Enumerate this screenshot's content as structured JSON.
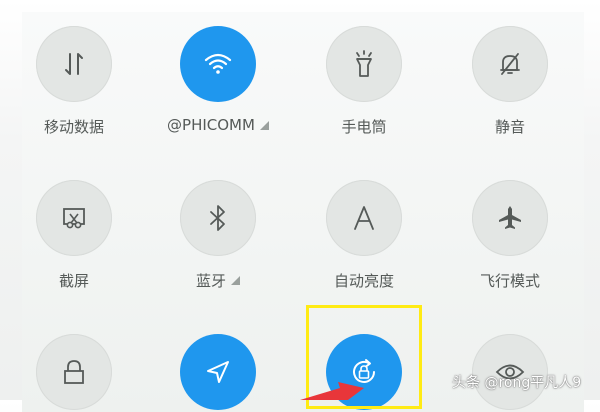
{
  "quick_settings": {
    "tiles": [
      {
        "label": "移动数据",
        "icon": "mobile-data-icon",
        "active": false
      },
      {
        "label": "@PHICOMM",
        "icon": "wifi-icon",
        "active": true,
        "has_submenu": true
      },
      {
        "label": "手电筒",
        "icon": "flashlight-icon",
        "active": false
      },
      {
        "label": "静音",
        "icon": "mute-bell-icon",
        "active": false
      },
      {
        "label": "截屏",
        "icon": "screenshot-icon",
        "active": false
      },
      {
        "label": "蓝牙",
        "icon": "bluetooth-icon",
        "active": false,
        "has_submenu": true
      },
      {
        "label": "自动亮度",
        "icon": "auto-brightness-icon",
        "active": false
      },
      {
        "label": "飞行模式",
        "icon": "airplane-icon",
        "active": false
      },
      {
        "label": "",
        "icon": "lock-icon",
        "active": false
      },
      {
        "label": "",
        "icon": "location-icon",
        "active": true
      },
      {
        "label": "",
        "icon": "rotation-lock-icon",
        "active": true
      },
      {
        "label": "",
        "icon": "eye-comfort-icon",
        "active": false
      }
    ]
  },
  "watermark": "头条 @rong平凡人9",
  "colors": {
    "active": "#1f97ee",
    "inactive": "#e3e6e4",
    "icon": "#555a58",
    "highlight": "#ffeb14",
    "arrow": "#e8363a"
  }
}
